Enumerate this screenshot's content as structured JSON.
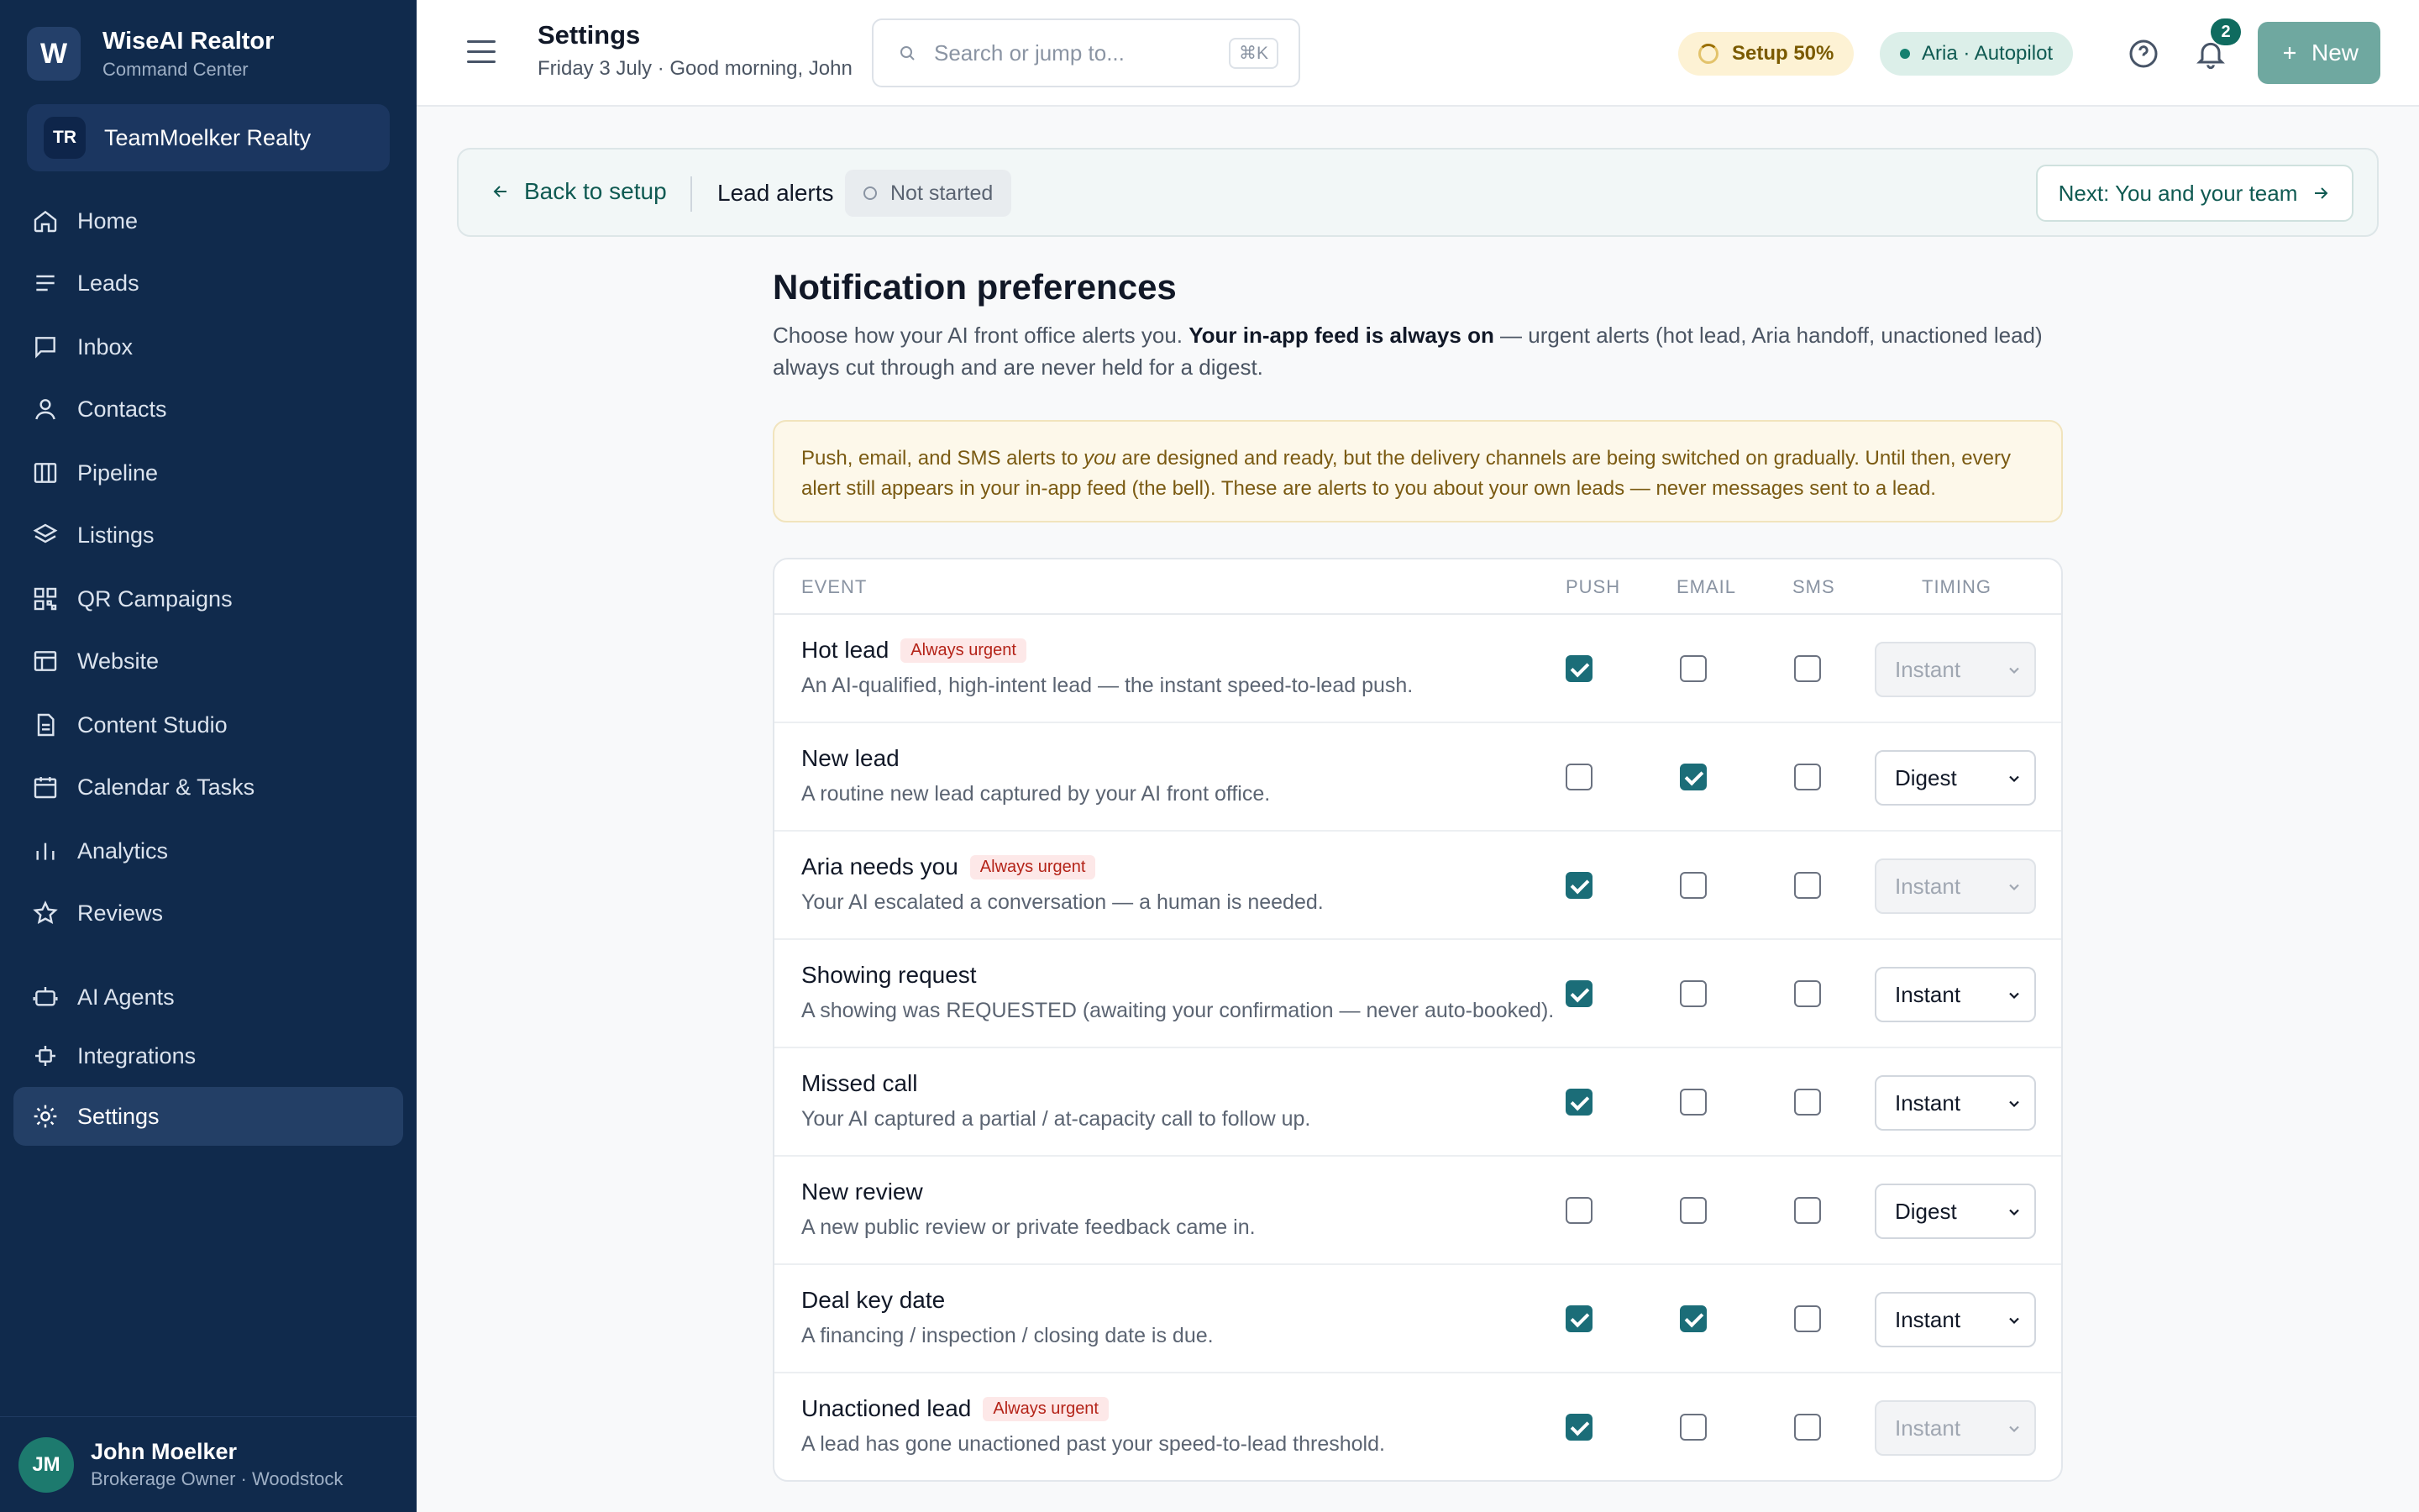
{
  "brand": {
    "logo_letter": "W",
    "name": "WiseAI Realtor",
    "subtitle": "Command Center"
  },
  "team": {
    "initials": "TR",
    "name": "TeamMoelker Realty"
  },
  "nav": [
    {
      "label": "Home",
      "icon": "home-icon"
    },
    {
      "label": "Leads",
      "icon": "list-icon"
    },
    {
      "label": "Inbox",
      "icon": "chat-icon"
    },
    {
      "label": "Contacts",
      "icon": "person-icon"
    },
    {
      "label": "Pipeline",
      "icon": "columns-icon"
    },
    {
      "label": "Listings",
      "icon": "layers-icon"
    },
    {
      "label": "QR Campaigns",
      "icon": "qr-icon"
    },
    {
      "label": "Website",
      "icon": "layout-icon"
    },
    {
      "label": "Content Studio",
      "icon": "document-icon"
    },
    {
      "label": "Calendar & Tasks",
      "icon": "calendar-icon"
    },
    {
      "label": "Analytics",
      "icon": "bar-chart-icon"
    },
    {
      "label": "Reviews",
      "icon": "star-icon"
    },
    {
      "label": "AI Agents",
      "icon": "robot-icon"
    },
    {
      "label": "Integrations",
      "icon": "plug-icon"
    },
    {
      "label": "Settings",
      "icon": "gear-icon",
      "active": true
    }
  ],
  "user": {
    "initials": "JM",
    "name": "John Moelker",
    "role": "Brokerage Owner · Woodstock"
  },
  "topbar": {
    "title": "Settings",
    "subtitle": "Friday 3 July · Good morning, John",
    "search_placeholder": "Search or jump to...",
    "shortcut": "⌘K",
    "setup_label": "Setup 50%",
    "aria_label": "Aria · Autopilot",
    "notification_count": "2",
    "new_label": "New"
  },
  "setup_bar": {
    "back_label": "Back to setup",
    "section": "Lead alerts",
    "status": "Not started",
    "next_label": "Next: You and your team"
  },
  "page": {
    "heading": "Notification preferences",
    "intro_1": "Choose how your AI front office alerts you. ",
    "intro_bold": "Your in-app feed is always on",
    "intro_2": " — urgent alerts (hot lead, Aria handoff, unactioned lead) always cut through and are never held for a digest.",
    "notice_1": "Push, email, and SMS alerts to ",
    "notice_em": "you",
    "notice_2": " are designed and ready, but the delivery channels are being switched on gradually. Until then, every alert still appears in your in-app feed (the bell). These are alerts to you about your own leads — never messages sent to a lead."
  },
  "table": {
    "headers": {
      "event": "EVENT",
      "push": "PUSH",
      "email": "EMAIL",
      "sms": "SMS",
      "timing": "TIMING"
    },
    "urgent_label": "Always urgent",
    "rows": [
      {
        "title": "Hot lead",
        "urgent": true,
        "desc": "An AI-qualified, high-intent lead — the instant speed-to-lead push.",
        "push": true,
        "email": false,
        "sms": false,
        "timing": "Instant",
        "disabled": true
      },
      {
        "title": "New lead",
        "urgent": false,
        "desc": "A routine new lead captured by your AI front office.",
        "push": false,
        "email": true,
        "sms": false,
        "timing": "Digest",
        "disabled": false
      },
      {
        "title": "Aria needs you",
        "urgent": true,
        "desc": "Your AI escalated a conversation — a human is needed.",
        "push": true,
        "email": false,
        "sms": false,
        "timing": "Instant",
        "disabled": true
      },
      {
        "title": "Showing request",
        "urgent": false,
        "desc": "A showing was REQUESTED (awaiting your confirmation — never auto-booked).",
        "push": true,
        "email": false,
        "sms": false,
        "timing": "Instant",
        "disabled": false
      },
      {
        "title": "Missed call",
        "urgent": false,
        "desc": "Your AI captured a partial / at-capacity call to follow up.",
        "push": true,
        "email": false,
        "sms": false,
        "timing": "Instant",
        "disabled": false
      },
      {
        "title": "New review",
        "urgent": false,
        "desc": "A new public review or private feedback came in.",
        "push": false,
        "email": false,
        "sms": false,
        "timing": "Digest",
        "disabled": false
      },
      {
        "title": "Deal key date",
        "urgent": false,
        "desc": "A financing / inspection / closing date is due.",
        "push": true,
        "email": true,
        "sms": false,
        "timing": "Instant",
        "disabled": false
      },
      {
        "title": "Unactioned lead",
        "urgent": true,
        "desc": "A lead has gone unactioned past your speed-to-lead threshold.",
        "push": true,
        "email": false,
        "sms": false,
        "timing": "Instant",
        "disabled": true
      }
    ]
  },
  "colors": {
    "sidebar": "#102a4c",
    "accent": "#1b6d78",
    "urgent": "#b42318"
  }
}
